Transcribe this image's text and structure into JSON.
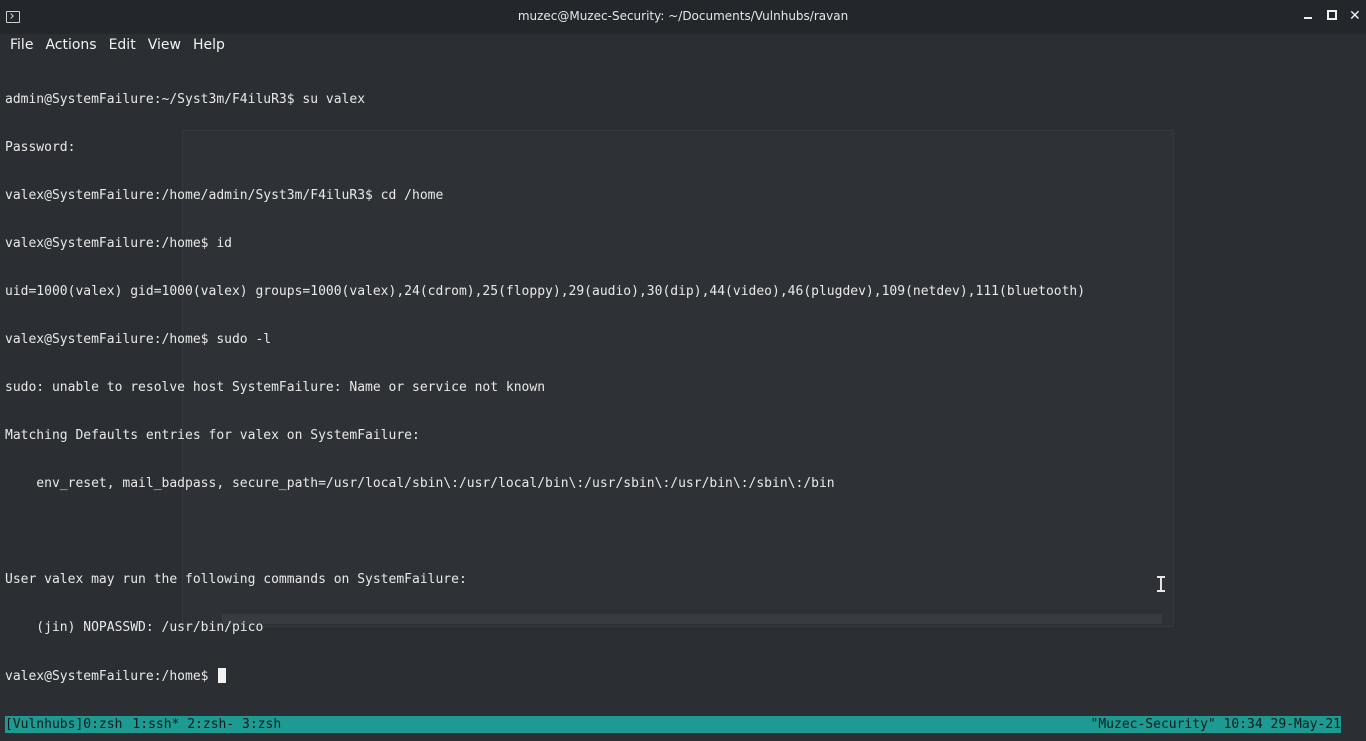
{
  "window": {
    "title": "muzec@Muzec-Security: ~/Documents/Vulnhubs/ravan",
    "icon": "terminal-icon"
  },
  "menu": {
    "items": [
      "File",
      "Actions",
      "Edit",
      "View",
      "Help"
    ]
  },
  "terminal": {
    "lines": [
      "admin@SystemFailure:~/Syst3m/F4iluR3$ su valex",
      "Password:",
      "valex@SystemFailure:/home/admin/Syst3m/F4iluR3$ cd /home",
      "valex@SystemFailure:/home$ id",
      "uid=1000(valex) gid=1000(valex) groups=1000(valex),24(cdrom),25(floppy),29(audio),30(dip),44(video),46(plugdev),109(netdev),111(bluetooth)",
      "valex@SystemFailure:/home$ sudo -l",
      "sudo: unable to resolve host SystemFailure: Name or service not known",
      "Matching Defaults entries for valex on SystemFailure:",
      "    env_reset, mail_badpass, secure_path=/usr/local/sbin\\:/usr/local/bin\\:/usr/sbin\\:/usr/bin\\:/sbin\\:/bin",
      "",
      "User valex may run the following commands on SystemFailure:",
      "    (jin) NOPASSWD: /usr/bin/pico"
    ],
    "prompt": "valex@SystemFailure:/home$ "
  },
  "statusbar": {
    "session": "[Vulnhubs]",
    "windows": [
      "0:zsh",
      "1:ssh*",
      "2:zsh-",
      "3:zsh"
    ],
    "host": "\"Muzec-Security\"",
    "time": "10:34",
    "date": "29-May-21"
  },
  "colors": {
    "status_bg": "#1d9a91",
    "terminal_bg": "#2b2f34",
    "titlebar_bg": "#23262a"
  }
}
